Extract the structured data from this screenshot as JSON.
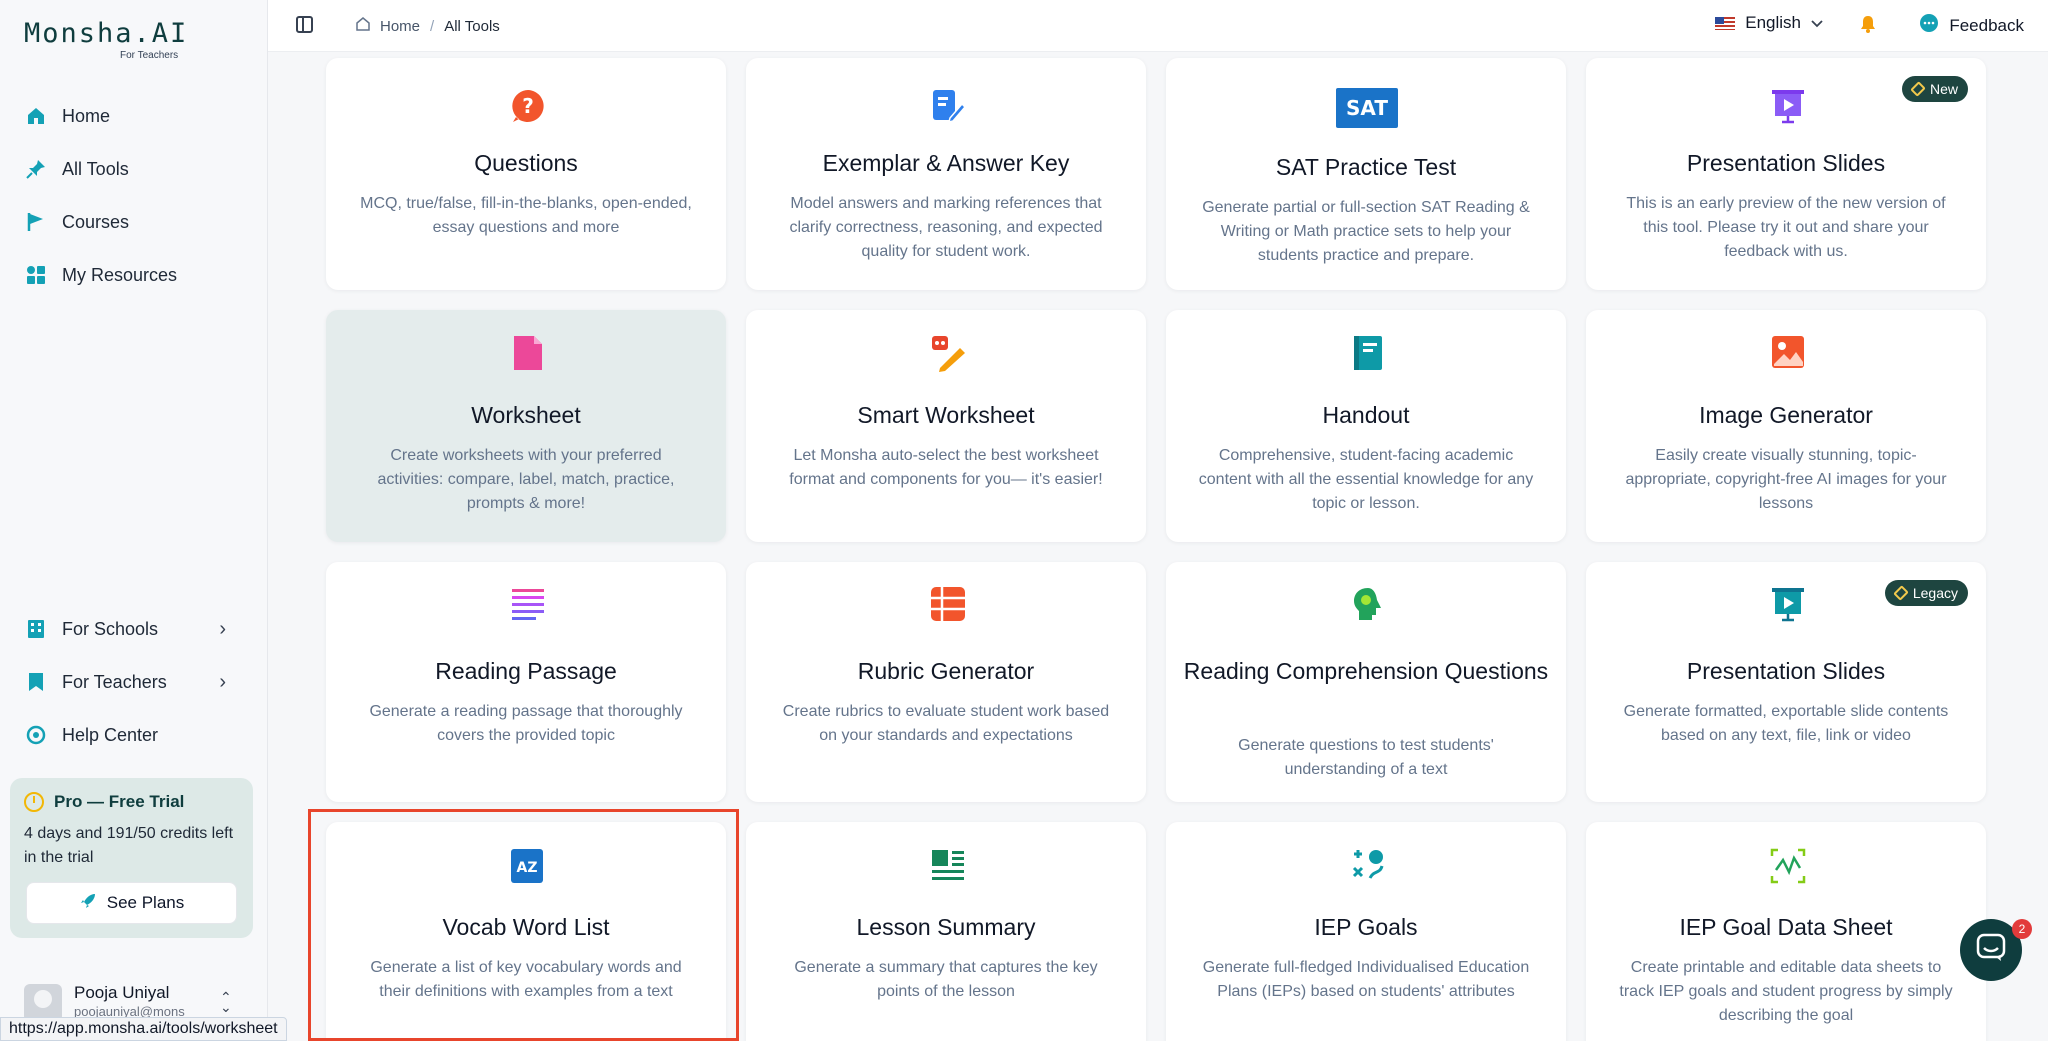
{
  "app": {
    "logo": "Monsha.AI",
    "logo_sub": "For Teachers"
  },
  "sidebar": {
    "items": [
      {
        "label": "Home",
        "icon": "home-icon"
      },
      {
        "label": "All Tools",
        "icon": "pin-icon"
      },
      {
        "label": "Courses",
        "icon": "flag-icon"
      },
      {
        "label": "My Resources",
        "icon": "resources-icon"
      }
    ],
    "bottom_items": [
      {
        "label": "For Schools",
        "icon": "building-icon"
      },
      {
        "label": "For Teachers",
        "icon": "bookmark-icon"
      },
      {
        "label": "Help Center",
        "icon": "help-icon"
      }
    ],
    "trial": {
      "title": "Pro — Free Trial",
      "text": "4 days and 191/50 credits left in the trial",
      "button": "See Plans"
    },
    "user": {
      "name": "Pooja Uniyal",
      "email": "poojauniyal@mons"
    }
  },
  "topbar": {
    "breadcrumb": [
      "Home",
      "All Tools"
    ],
    "language": "English",
    "feedback": "Feedback"
  },
  "status_url": "https://app.monsha.ai/tools/worksheet",
  "cards": [
    {
      "title": "Questions",
      "desc": "MCQ, true/false, fill-in-the-blanks, open-ended, essay questions and more",
      "icon": "question-icon"
    },
    {
      "title": "Exemplar & Answer Key",
      "desc": "Model answers and marking references that clarify correctness, reasoning, and expected quality for student work.",
      "icon": "answer-key-icon"
    },
    {
      "title": "SAT Practice Test",
      "desc": "Generate partial or full-section SAT Reading & Writing or Math practice sets to help your students practice and prepare.",
      "icon": "sat-icon",
      "icon_text": "SAT"
    },
    {
      "title": "Presentation Slides",
      "desc": "This is an early preview of the new version of this tool. Please try it out and share your feedback with us.",
      "icon": "presentation-icon",
      "badge": "New"
    },
    {
      "title": "Worksheet",
      "desc": "Create worksheets with your preferred activities: compare, label, match, practice, prompts & more!",
      "icon": "worksheet-icon"
    },
    {
      "title": "Smart Worksheet",
      "desc": "Let Monsha auto-select the best worksheet format and components for you— it's easier!",
      "icon": "smart-worksheet-icon"
    },
    {
      "title": "Handout",
      "desc": "Comprehensive, student-facing academic content with all the essential knowledge for any topic or lesson.",
      "icon": "handout-icon"
    },
    {
      "title": "Image Generator",
      "desc": "Easily create visually stunning, topic-appropriate, copyright-free AI images for your lessons",
      "icon": "image-icon"
    },
    {
      "title": "Reading Passage",
      "desc": "Generate a reading passage that thoroughly covers the provided topic",
      "icon": "reading-passage-icon"
    },
    {
      "title": "Rubric Generator",
      "desc": "Create rubrics to evaluate student work based on your standards and expectations",
      "icon": "rubric-icon"
    },
    {
      "title": "Reading Comprehension Questions",
      "desc": "Generate questions to test students' understanding of a text",
      "icon": "brain-icon"
    },
    {
      "title": "Presentation Slides",
      "desc": "Generate formatted, exportable slide contents based on any text, file, link or video",
      "icon": "presentation-legacy-icon",
      "badge": "Legacy"
    },
    {
      "title": "Vocab Word List",
      "desc": "Generate a list of key vocabulary words and their definitions with examples from a text",
      "icon": "vocab-icon",
      "icon_text": "AZ"
    },
    {
      "title": "Lesson Summary",
      "desc": "Generate a summary that captures the key points of the lesson",
      "icon": "summary-icon"
    },
    {
      "title": "IEP Goals",
      "desc": "Generate full-fledged Individualised Education Plans (IEPs) based on students' attributes",
      "icon": "iep-goals-icon"
    },
    {
      "title": "IEP Goal Data Sheet",
      "desc": "Create printable and editable data sheets to track IEP goals and student progress by simply describing the goal",
      "icon": "data-sheet-icon"
    }
  ],
  "chat": {
    "count": "2"
  },
  "colors": {
    "brand": "#0f3d3e",
    "accent_teal": "#14a1b5",
    "highlight": "#e8452c",
    "badge_bg": "#1e4540"
  }
}
